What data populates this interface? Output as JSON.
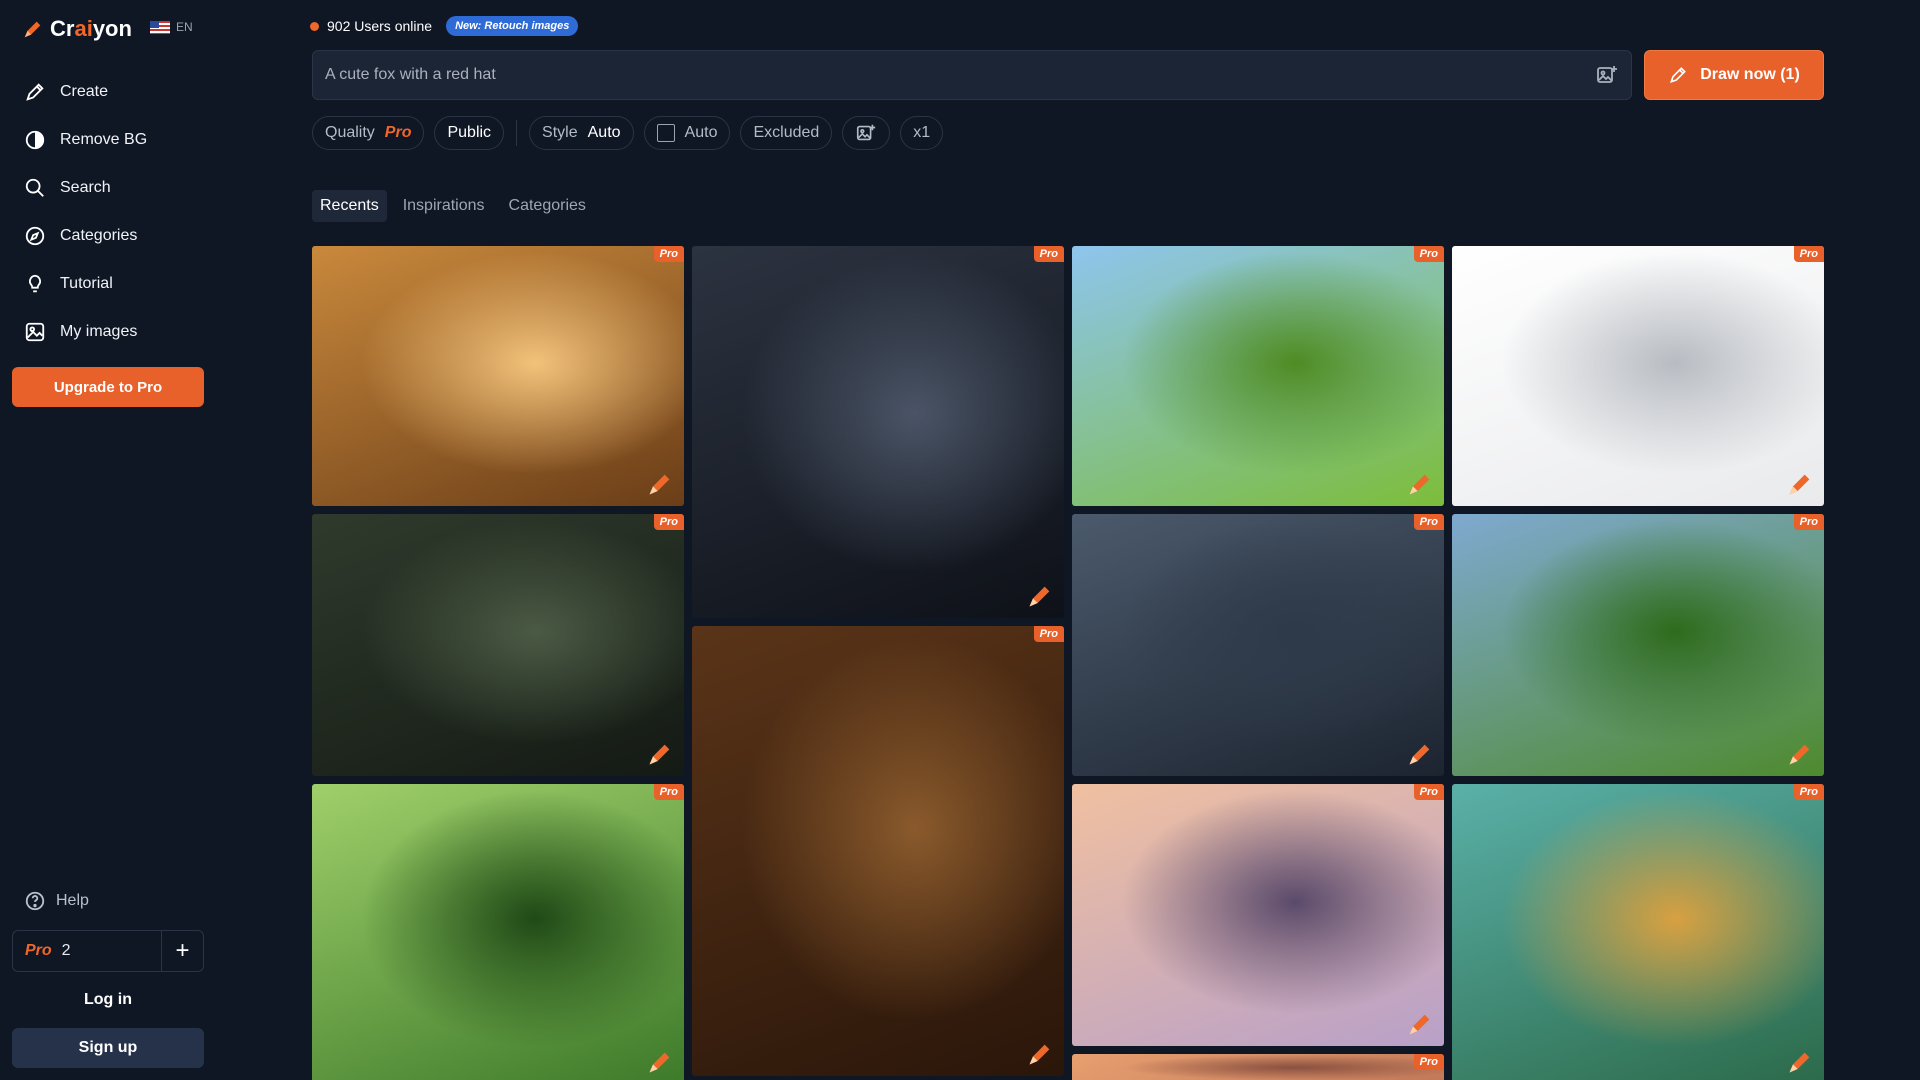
{
  "app": {
    "logo_text_start": "Cr",
    "logo_text_ai": "ai",
    "logo_text_end": "yon",
    "lang": "EN"
  },
  "sidebar": {
    "items": [
      {
        "label": "Create",
        "icon": "pencil-icon"
      },
      {
        "label": "Remove BG",
        "icon": "half-circle-icon"
      },
      {
        "label": "Search",
        "icon": "search-icon"
      },
      {
        "label": "Categories",
        "icon": "compass-icon"
      },
      {
        "label": "Tutorial",
        "icon": "lightbulb-icon"
      },
      {
        "label": "My images",
        "icon": "image-icon"
      }
    ],
    "upgrade_label": "Upgrade to Pro",
    "help_label": "Help",
    "pro_label": "Pro",
    "pro_count": "2",
    "plus_label": "+",
    "login_label": "Log in",
    "signup_label": "Sign up"
  },
  "top": {
    "users_online": "902 Users online",
    "badge": "New: Retouch images"
  },
  "prompt": {
    "placeholder": "A cute fox with a red hat",
    "draw_label": "Draw now (1)"
  },
  "options": {
    "quality_label": "Quality",
    "quality_value": "Pro",
    "visibility": "Public",
    "style_label": "Style",
    "style_value": "Auto",
    "ratio_value": "Auto",
    "excluded_label": "Excluded",
    "count": "x1"
  },
  "tabs": [
    "Recents",
    "Inspirations",
    "Categories"
  ],
  "gallery": {
    "badge": "Pro",
    "cards": [
      {
        "name": "card-mushroom-brush",
        "colors": [
          "#c9893c",
          "#6b3e18",
          "#f2c27a"
        ]
      },
      {
        "name": "card-gothic-woman-gown",
        "colors": [
          "#2c3340",
          "#0e1118",
          "#4a5466"
        ]
      },
      {
        "name": "card-duck-scooter",
        "colors": [
          "#8ec5ee",
          "#7cbd3a",
          "#4f8c24"
        ]
      },
      {
        "name": "card-metal-spring",
        "colors": [
          "#ffffff",
          "#e9eaec",
          "#b8bcc2"
        ]
      },
      {
        "name": "card-gothic-woman-candles",
        "colors": [
          "#2f3a2c",
          "#141a14",
          "#4b5a44"
        ]
      },
      {
        "name": "card-library",
        "colors": [
          "#5a3418",
          "#2a160a",
          "#8a5a2c"
        ]
      },
      {
        "name": "card-spring-workshop",
        "colors": [
          "#4b5a6c",
          "#1c2430",
          "#2e3a4a"
        ]
      },
      {
        "name": "card-minecraft-landscape",
        "colors": [
          "#7fa9d0",
          "#4e8a2e",
          "#2f6b1c"
        ]
      },
      {
        "name": "card-jungle-capybara",
        "colors": [
          "#9fcf6a",
          "#3d7a2a",
          "#1f4a16"
        ]
      },
      {
        "name": "card-princess-meadow",
        "colors": [
          "#f0c0a0",
          "#b8a0c8",
          "#5a4a6a"
        ]
      },
      {
        "name": "card-capybara-forest",
        "colors": [
          "#5ab0a8",
          "#2c6a4a",
          "#d8a040"
        ]
      },
      {
        "name": "card-sunset",
        "colors": [
          "#e8a070",
          "#c07858",
          "#8a5040"
        ]
      }
    ]
  }
}
